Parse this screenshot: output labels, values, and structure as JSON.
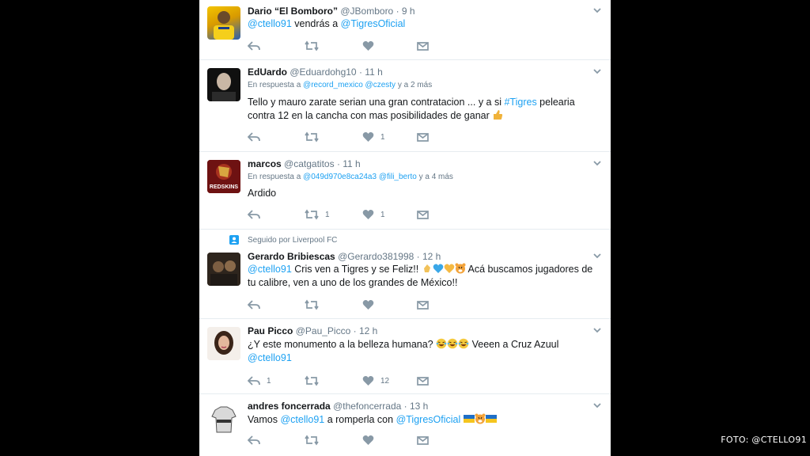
{
  "tweets": [
    {
      "name": "Dario “El Bomboro”",
      "handle": "@JBomboro",
      "time": "· 9 h",
      "text_parts": [
        {
          "t": "@ctello91",
          "m": true
        },
        {
          "t": " vendrás a ",
          "m": false
        },
        {
          "t": "@TigresOficial",
          "m": true
        }
      ],
      "reply_count": "",
      "retweet_count": "",
      "like_count": ""
    },
    {
      "name": "EdUardo",
      "handle": "@Eduardohg10",
      "time": "· 11 h",
      "reply_prefix": "En respuesta a",
      "reply_mentions": "@record_mexico @czesty",
      "reply_suffix": "y a 2 más",
      "text_line1_a": "Tello y mauro zarate serian una gran contratacion ... y a si ",
      "text_line1_tag": "#Tigres",
      "text_line1_b": " pelearia",
      "text_line2": "contra 12 en la cancha con mas posibilidades de ganar",
      "like_count": "1"
    },
    {
      "name": "marcos",
      "handle": "@catgatitos",
      "time": "· 11 h",
      "reply_prefix": "En respuesta a",
      "reply_mentions": "@049d970e8ca24a3 @fili_berto",
      "reply_suffix": "y a 4 más",
      "text": "Ardido",
      "retweet_count": "1",
      "like_count": "1",
      "avatar_label": "REDSKINS"
    },
    {
      "social_context": "Seguido por Liverpool FC",
      "name": "Gerardo Bribiescas",
      "handle": "@Gerardo381998",
      "time": "· 12 h",
      "text_mention": "@ctello91",
      "text_line1": " Cris ven a Tigres y se Feliz!! ",
      "text_line1_end": " Acá buscamos jugadores de",
      "text_line2": "tu calibre, ven a uno de los grandes de México!!"
    },
    {
      "name": "Pau Picco",
      "handle": "@Pau_Picco",
      "time": "· 12 h",
      "text_line1_a": "¿Y este monumento a la belleza humana? ",
      "text_line1_b": " Veeen a Cruz Azuul",
      "text_line2_mention": "@ctello91",
      "reply_count": "1",
      "like_count": "12"
    },
    {
      "name": "andres foncerrada",
      "handle": "@thefoncerrada",
      "time": "· 13 h",
      "text_a": "Vamos ",
      "text_mention1": "@ctello91",
      "text_b": "  a romperla con ",
      "text_mention2": "@TigresOficial"
    }
  ],
  "credit": "FOTO: @CTELLO91",
  "colors": {
    "link": "#1da1f2",
    "secondary": "#657786",
    "divider": "#e6ecf0",
    "background": "#000000"
  },
  "icons": [
    "reply-icon",
    "retweet-icon",
    "like-icon",
    "dm-icon",
    "caret-down-icon",
    "follow-icon"
  ]
}
